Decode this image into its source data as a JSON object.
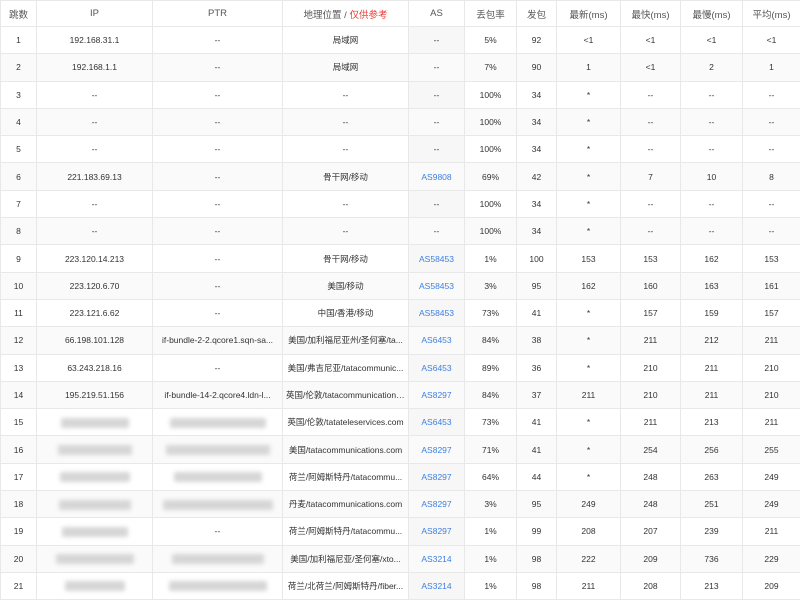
{
  "colors": {
    "accent": "#e8413a",
    "link": "#3d7fe0",
    "border": "#e8e8e8"
  },
  "headers": {
    "hop": "跳数",
    "ip": "IP",
    "ptr": "PTR",
    "geo": "地理位置",
    "geo_sep": " / ",
    "geo_note": "仅供参考",
    "as": "AS",
    "loss": "丢包率",
    "sent": "发包",
    "last": "最新(ms)",
    "best": "最快(ms)",
    "worst": "最慢(ms)",
    "avg": "平均(ms)"
  },
  "rows": [
    {
      "hop": "1",
      "ip": "192.168.31.1",
      "ptr": "--",
      "geo": "局域网",
      "as": "--",
      "as_link": false,
      "loss": "5%",
      "sent": "92",
      "last": "<1",
      "best": "<1",
      "worst": "<1",
      "avg": "<1"
    },
    {
      "hop": "2",
      "ip": "192.168.1.1",
      "ptr": "--",
      "geo": "局域网",
      "as": "--",
      "as_link": false,
      "loss": "7%",
      "sent": "90",
      "last": "1",
      "best": "<1",
      "worst": "2",
      "avg": "1"
    },
    {
      "hop": "3",
      "ip": "--",
      "ptr": "--",
      "geo": "--",
      "as": "--",
      "as_link": false,
      "loss": "100%",
      "sent": "34",
      "last": "*",
      "best": "--",
      "worst": "--",
      "avg": "--"
    },
    {
      "hop": "4",
      "ip": "--",
      "ptr": "--",
      "geo": "--",
      "as": "--",
      "as_link": false,
      "loss": "100%",
      "sent": "34",
      "last": "*",
      "best": "--",
      "worst": "--",
      "avg": "--"
    },
    {
      "hop": "5",
      "ip": "--",
      "ptr": "--",
      "geo": "--",
      "as": "--",
      "as_link": false,
      "loss": "100%",
      "sent": "34",
      "last": "*",
      "best": "--",
      "worst": "--",
      "avg": "--"
    },
    {
      "hop": "6",
      "ip": "221.183.69.13",
      "ptr": "--",
      "geo": "骨干网/移动",
      "as": "AS9808",
      "as_link": true,
      "loss": "69%",
      "sent": "42",
      "last": "*",
      "best": "7",
      "worst": "10",
      "avg": "8"
    },
    {
      "hop": "7",
      "ip": "--",
      "ptr": "--",
      "geo": "--",
      "as": "--",
      "as_link": false,
      "loss": "100%",
      "sent": "34",
      "last": "*",
      "best": "--",
      "worst": "--",
      "avg": "--"
    },
    {
      "hop": "8",
      "ip": "--",
      "ptr": "--",
      "geo": "--",
      "as": "--",
      "as_link": false,
      "loss": "100%",
      "sent": "34",
      "last": "*",
      "best": "--",
      "worst": "--",
      "avg": "--"
    },
    {
      "hop": "9",
      "ip": "223.120.14.213",
      "ptr": "--",
      "geo": "骨干网/移动",
      "as": "AS58453",
      "as_link": true,
      "loss": "1%",
      "sent": "100",
      "last": "153",
      "best": "153",
      "worst": "162",
      "avg": "153"
    },
    {
      "hop": "10",
      "ip": "223.120.6.70",
      "ptr": "--",
      "geo": "美国/移动",
      "as": "AS58453",
      "as_link": true,
      "loss": "3%",
      "sent": "95",
      "last": "162",
      "best": "160",
      "worst": "163",
      "avg": "161"
    },
    {
      "hop": "11",
      "ip": "223.121.6.62",
      "ptr": "--",
      "geo": "中国/香港/移动",
      "as": "AS58453",
      "as_link": true,
      "loss": "73%",
      "sent": "41",
      "last": "*",
      "best": "157",
      "worst": "159",
      "avg": "157"
    },
    {
      "hop": "12",
      "ip": "66.198.101.128",
      "ptr": "if-bundle-2-2.qcore1.sqn-sa...",
      "geo": "美国/加利福尼亚州/圣何塞/ta...",
      "as": "AS6453",
      "as_link": true,
      "loss": "84%",
      "sent": "38",
      "last": "*",
      "best": "211",
      "worst": "212",
      "avg": "211"
    },
    {
      "hop": "13",
      "ip": "63.243.218.16",
      "ptr": "--",
      "geo": "美国/弗吉尼亚/tatacommunic...",
      "as": "AS6453",
      "as_link": true,
      "loss": "89%",
      "sent": "36",
      "last": "*",
      "best": "210",
      "worst": "211",
      "avg": "210"
    },
    {
      "hop": "14",
      "ip": "195.219.51.156",
      "ptr": "if-bundle-14-2.qcore4.ldn-l...",
      "geo": "英国/伦敦/tatacommunications...",
      "as": "AS8297",
      "as_link": true,
      "loss": "84%",
      "sent": "37",
      "last": "211",
      "best": "210",
      "worst": "211",
      "avg": "210"
    },
    {
      "hop": "15",
      "ip": "",
      "ip_blur": true,
      "ptr": "",
      "ptr_blur": true,
      "geo": "英国/伦敦/tatateleservices.com",
      "as": "AS6453",
      "as_link": true,
      "loss": "73%",
      "sent": "41",
      "last": "*",
      "best": "211",
      "worst": "213",
      "avg": "211"
    },
    {
      "hop": "16",
      "ip": "",
      "ip_blur": true,
      "ptr": "",
      "ptr_blur": true,
      "geo": "美国/tatacommunications.com",
      "as": "AS8297",
      "as_link": true,
      "loss": "71%",
      "sent": "41",
      "last": "*",
      "best": "254",
      "worst": "256",
      "avg": "255"
    },
    {
      "hop": "17",
      "ip": "",
      "ip_blur": true,
      "ptr": "",
      "ptr_blur": true,
      "geo": "荷兰/阿姆斯特丹/tatacommu...",
      "as": "AS8297",
      "as_link": true,
      "loss": "64%",
      "sent": "44",
      "last": "*",
      "best": "248",
      "worst": "263",
      "avg": "249"
    },
    {
      "hop": "18",
      "ip": "",
      "ip_blur": true,
      "ptr": "",
      "ptr_blur": true,
      "geo": "丹麦/tatacommunications.com",
      "as": "AS8297",
      "as_link": true,
      "loss": "3%",
      "sent": "95",
      "last": "249",
      "best": "248",
      "worst": "251",
      "avg": "249"
    },
    {
      "hop": "19",
      "ip": "",
      "ip_blur": true,
      "ptr": "--",
      "geo": "荷兰/阿姆斯特丹/tatacommu...",
      "as": "AS8297",
      "as_link": true,
      "loss": "1%",
      "sent": "99",
      "last": "208",
      "best": "207",
      "worst": "239",
      "avg": "211"
    },
    {
      "hop": "20",
      "ip": "",
      "ip_blur": true,
      "ptr": "",
      "ptr_blur": true,
      "geo": "美国/加利福尼亚/圣何塞/xto...",
      "as": "AS3214",
      "as_link": true,
      "loss": "1%",
      "sent": "98",
      "last": "222",
      "best": "209",
      "worst": "736",
      "avg": "229"
    },
    {
      "hop": "21",
      "ip": "",
      "ip_blur": true,
      "ptr": "",
      "ptr_blur": true,
      "geo": "荷兰/北荷兰/阿姆斯特丹/fiber...",
      "as": "AS3214",
      "as_link": true,
      "loss": "1%",
      "sent": "98",
      "last": "211",
      "best": "208",
      "worst": "213",
      "avg": "209"
    }
  ]
}
